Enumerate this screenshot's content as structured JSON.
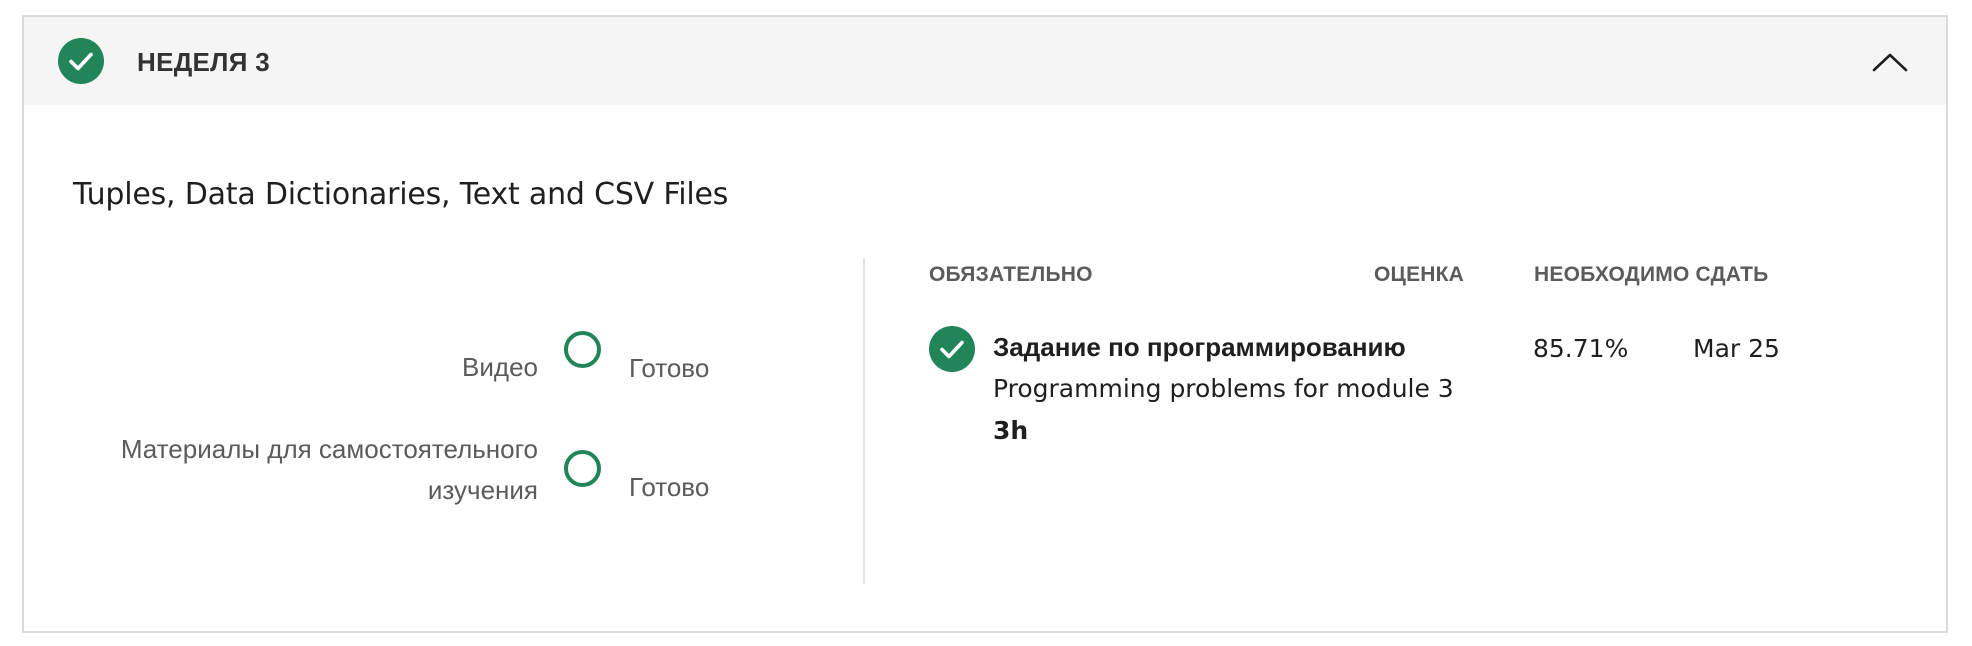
{
  "week": {
    "title": "НЕДЕЛЯ 3",
    "completed": true,
    "expanded": true
  },
  "module": {
    "title": "Tuples, Data Dictionaries, Text and CSV Files"
  },
  "materials": [
    {
      "label": "Видео",
      "status": "Готово"
    },
    {
      "label_line1": "Материалы для самостоятельного",
      "label_line2": "изучения",
      "status": "Готово"
    }
  ],
  "assignments_table": {
    "headers": {
      "required": "ОБЯЗАТЕЛЬНО",
      "grade": "ОЦЕНКА",
      "due": "НЕОБХОДИМО СДАТЬ"
    },
    "rows": [
      {
        "type": "Задание по программированию",
        "description": "Programming problems for module 3",
        "duration": "3h",
        "grade": "85.71%",
        "due": "Mar 25",
        "completed": true
      }
    ]
  },
  "colors": {
    "accent_green": "#218559",
    "header_bg": "#f5f5f5",
    "border": "#dadada"
  },
  "icons": {
    "week_status": "check-circle-icon",
    "toggle": "chevron-up-icon",
    "material_status": "empty-circle-icon",
    "assignment_status": "check-circle-icon"
  }
}
